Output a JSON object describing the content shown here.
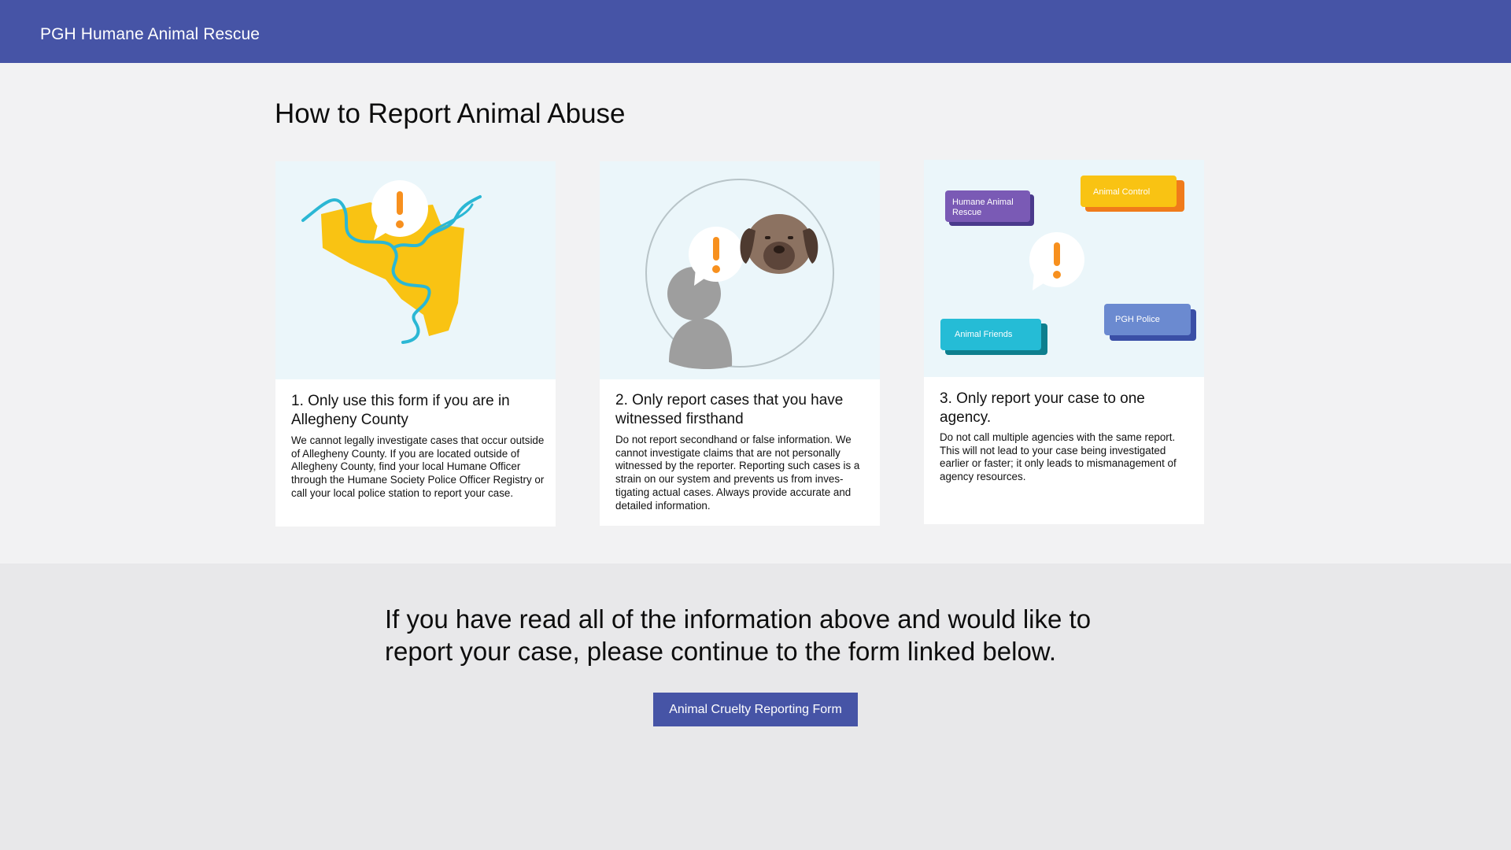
{
  "header": {
    "brand": "PGH Humane Animal Rescue"
  },
  "main": {
    "title": "How to Report Animal Abuse",
    "cards": [
      {
        "heading": "1. Only use this form if you are in Allegheny County",
        "body": "We cannot legally investigate cases that occur outside of Allegheny County. If you are located outside of Allegheny County, find your local Humane Officer through the Humane Society Police Officer Registry or call your local police station to report your case."
      },
      {
        "heading": "2. Only report cases that you have witnessed firsthand",
        "body": "Do not report secondhand or false information. We cannot investigate claims that are not personally witnessed by the reporter. Reporting such cases is a strain on our system and prevents us from inves-tigating actual cases. Always provide accurate and detailed information."
      },
      {
        "heading": "3. Only report your case to one agency.",
        "body": "Do not call multiple agencies with the same report. This will not lead to your case being investigated earlier or faster; it only leads to mismanagement of agency resources.",
        "agencies": [
          "Humane Animal Rescue",
          "Animal Control",
          "Animal Friends",
          "PGH Police"
        ]
      }
    ]
  },
  "cta": {
    "text": "If you have read all of the information above and would like to report your case, please continue to the form linked below.",
    "button_label": "Animal Cruelty Reporting Form"
  },
  "colors": {
    "header": "#4654a6",
    "alert": "#f7901e",
    "county": "#f9c313",
    "river": "#2bb7d4"
  },
  "icons": [
    "exclamation-bubble-icon",
    "county-map-icon",
    "person-icon",
    "dog-icon"
  ]
}
